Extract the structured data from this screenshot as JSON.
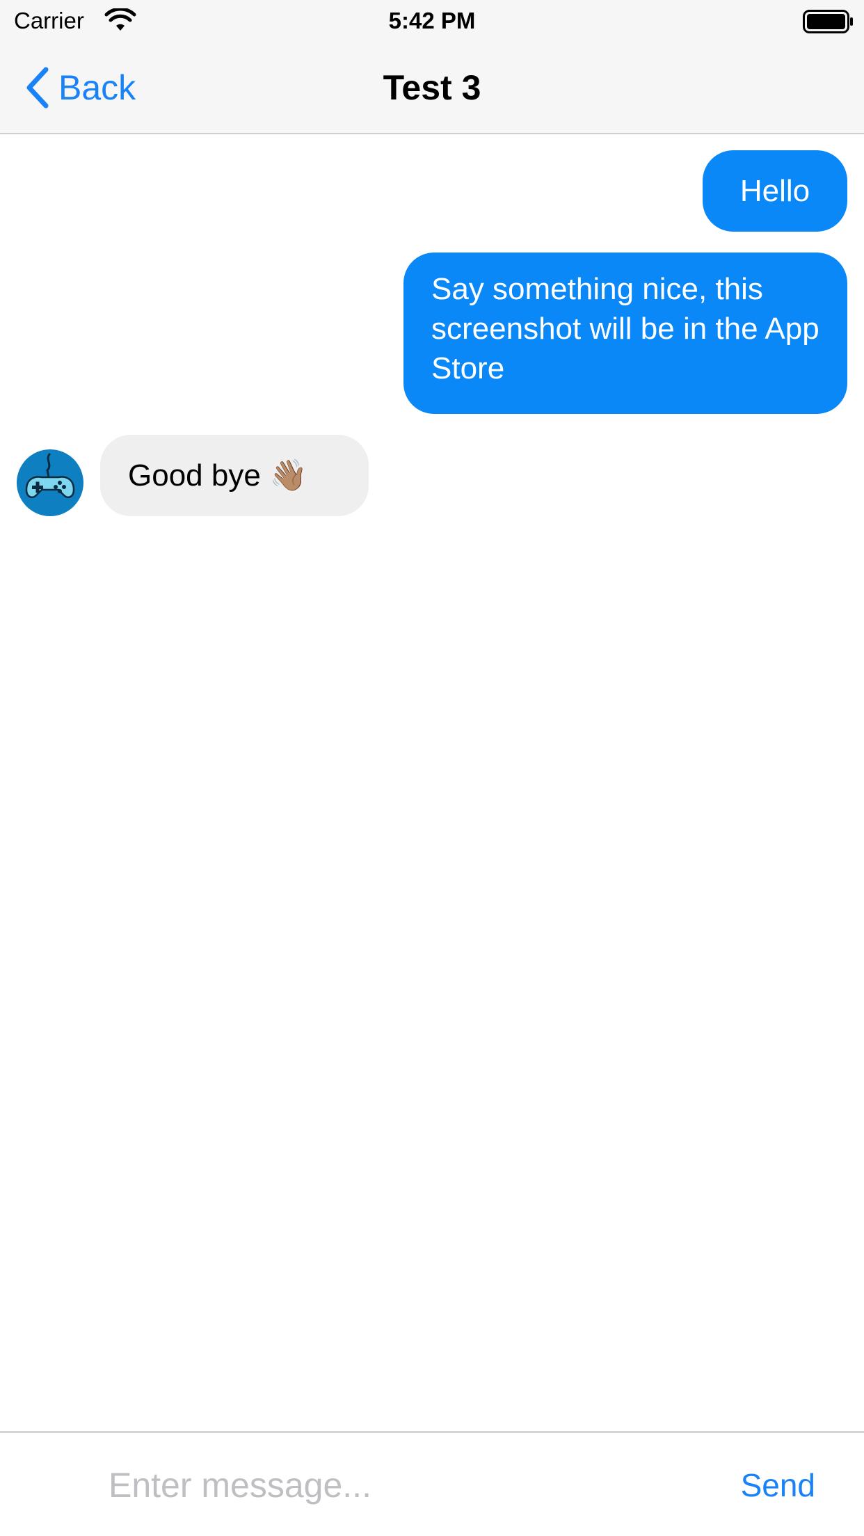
{
  "status_bar": {
    "carrier": "Carrier",
    "time": "5:42 PM"
  },
  "nav": {
    "back_label": "Back",
    "title": "Test 3"
  },
  "messages": [
    {
      "direction": "outgoing",
      "text": "Hello"
    },
    {
      "direction": "outgoing",
      "text": "Say something nice, this screenshot will be in the App Store"
    },
    {
      "direction": "incoming",
      "text": "Good bye 👋🏽"
    }
  ],
  "composer": {
    "placeholder": "Enter message...",
    "value": "",
    "send_label": "Send"
  },
  "colors": {
    "accent": "#1a82f7",
    "outgoing_bubble": "#0a88f7",
    "incoming_bubble": "#efefef",
    "bar_background": "#f6f6f6",
    "avatar_background": "#0e7fc0"
  },
  "icons": {
    "wifi": "wifi-icon",
    "battery": "battery-icon",
    "back": "chevron-left-icon",
    "avatar": "gamepad-icon"
  }
}
